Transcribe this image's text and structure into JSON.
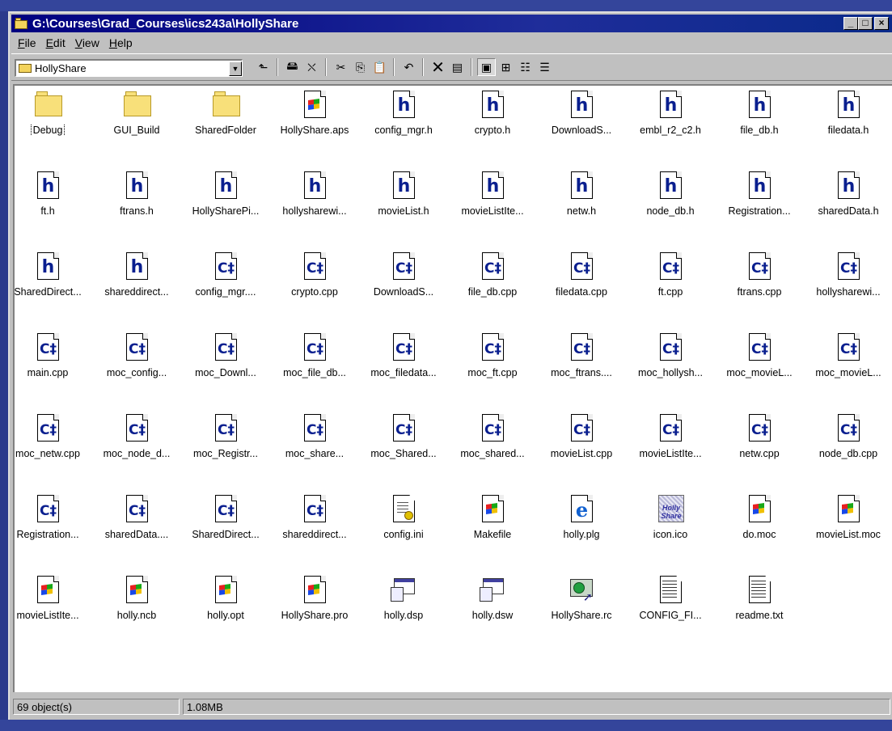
{
  "window": {
    "title": "G:\\Courses\\Grad_Courses\\ics243a\\HollyShare",
    "minimize_label": "_",
    "maximize_label": "□",
    "close_label": "×"
  },
  "menu": {
    "items": [
      {
        "key": "F",
        "rest": "ile"
      },
      {
        "key": "E",
        "rest": "dit"
      },
      {
        "key": "V",
        "rest": "iew"
      },
      {
        "key": "H",
        "rest": "elp"
      }
    ]
  },
  "toolbar": {
    "address_value": "HollyShare",
    "buttons": [
      "up-folder",
      "map-drive",
      "disconnect-drive",
      "cut",
      "copy",
      "paste",
      "undo",
      "delete",
      "properties",
      "large-icons",
      "small-icons",
      "list",
      "details"
    ],
    "active_view": "large-icons"
  },
  "files": [
    {
      "name": "Debug",
      "type": "folder"
    },
    {
      "name": "GUI_Build",
      "type": "folder"
    },
    {
      "name": "SharedFolder",
      "type": "folder"
    },
    {
      "name": "HollyShare.aps",
      "type": "generic"
    },
    {
      "name": "config_mgr.h",
      "type": "h"
    },
    {
      "name": "crypto.h",
      "type": "h"
    },
    {
      "name": "DownloadS...",
      "type": "h"
    },
    {
      "name": "embl_r2_c2.h",
      "type": "h"
    },
    {
      "name": "file_db.h",
      "type": "h"
    },
    {
      "name": "filedata.h",
      "type": "h"
    },
    {
      "name": "ft.h",
      "type": "h"
    },
    {
      "name": "ftrans.h",
      "type": "h"
    },
    {
      "name": "HollySharePi...",
      "type": "h"
    },
    {
      "name": "hollysharewi...",
      "type": "h"
    },
    {
      "name": "movieList.h",
      "type": "h"
    },
    {
      "name": "movieListIte...",
      "type": "h"
    },
    {
      "name": "netw.h",
      "type": "h"
    },
    {
      "name": "node_db.h",
      "type": "h"
    },
    {
      "name": "Registration...",
      "type": "h"
    },
    {
      "name": "sharedData.h",
      "type": "h"
    },
    {
      "name": "SharedDirect...",
      "type": "h"
    },
    {
      "name": "shareddirect...",
      "type": "h"
    },
    {
      "name": "config_mgr....",
      "type": "cpp"
    },
    {
      "name": "crypto.cpp",
      "type": "cpp"
    },
    {
      "name": "DownloadS...",
      "type": "cpp"
    },
    {
      "name": "file_db.cpp",
      "type": "cpp"
    },
    {
      "name": "filedata.cpp",
      "type": "cpp"
    },
    {
      "name": "ft.cpp",
      "type": "cpp"
    },
    {
      "name": "ftrans.cpp",
      "type": "cpp"
    },
    {
      "name": "hollysharewi...",
      "type": "cpp"
    },
    {
      "name": "main.cpp",
      "type": "cpp"
    },
    {
      "name": "moc_config...",
      "type": "cpp"
    },
    {
      "name": "moc_Downl...",
      "type": "cpp"
    },
    {
      "name": "moc_file_db...",
      "type": "cpp"
    },
    {
      "name": "moc_filedata...",
      "type": "cpp"
    },
    {
      "name": "moc_ft.cpp",
      "type": "cpp"
    },
    {
      "name": "moc_ftrans....",
      "type": "cpp"
    },
    {
      "name": "moc_hollysh...",
      "type": "cpp"
    },
    {
      "name": "moc_movieL...",
      "type": "cpp"
    },
    {
      "name": "moc_movieL...",
      "type": "cpp"
    },
    {
      "name": "moc_netw.cpp",
      "type": "cpp"
    },
    {
      "name": "moc_node_d...",
      "type": "cpp"
    },
    {
      "name": "moc_Registr...",
      "type": "cpp"
    },
    {
      "name": "moc_share...",
      "type": "cpp"
    },
    {
      "name": "moc_Shared...",
      "type": "cpp"
    },
    {
      "name": "moc_shared...",
      "type": "cpp"
    },
    {
      "name": "movieList.cpp",
      "type": "cpp"
    },
    {
      "name": "movieListIte...",
      "type": "cpp"
    },
    {
      "name": "netw.cpp",
      "type": "cpp"
    },
    {
      "name": "node_db.cpp",
      "type": "cpp"
    },
    {
      "name": "Registration...",
      "type": "cpp"
    },
    {
      "name": "sharedData....",
      "type": "cpp"
    },
    {
      "name": "SharedDirect...",
      "type": "cpp"
    },
    {
      "name": "shareddirect...",
      "type": "cpp"
    },
    {
      "name": "config.ini",
      "type": "ini"
    },
    {
      "name": "Makefile",
      "type": "generic"
    },
    {
      "name": "holly.plg",
      "type": "ie"
    },
    {
      "name": "icon.ico",
      "type": "ico"
    },
    {
      "name": "do.moc",
      "type": "generic"
    },
    {
      "name": "movieList.moc",
      "type": "generic"
    },
    {
      "name": "movieListIte...",
      "type": "generic"
    },
    {
      "name": "holly.ncb",
      "type": "generic"
    },
    {
      "name": "holly.opt",
      "type": "generic"
    },
    {
      "name": "HollyShare.pro",
      "type": "generic"
    },
    {
      "name": "holly.dsp",
      "type": "dsp"
    },
    {
      "name": "holly.dsw",
      "type": "dsp"
    },
    {
      "name": "HollyShare.rc",
      "type": "rc"
    },
    {
      "name": "CONFIG_FI...",
      "type": "txt"
    },
    {
      "name": "readme.txt",
      "type": "txt"
    }
  ],
  "icon_glyphs": {
    "h": "h",
    "cpp": "C‡",
    "ico": "Holly Share"
  },
  "status": {
    "objects": "69 object(s)",
    "size": "1.08MB"
  }
}
